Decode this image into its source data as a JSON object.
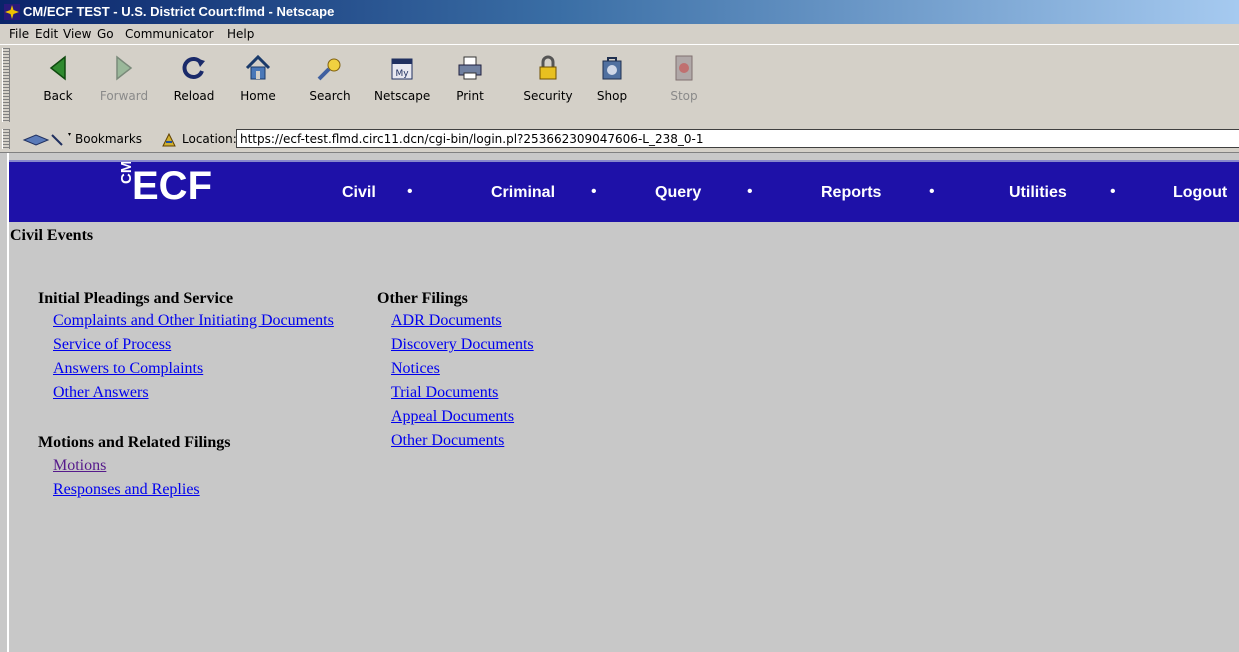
{
  "window": {
    "title": "CM/ECF TEST - U.S. District Court:flmd - Netscape"
  },
  "menu": [
    "File",
    "Edit",
    "View",
    "Go",
    "Communicator",
    "Help"
  ],
  "toolbar": {
    "back": "Back",
    "forward": "Forward",
    "reload": "Reload",
    "home": "Home",
    "search": "Search",
    "netscape": "Netscape",
    "print": "Print",
    "security": "Security",
    "shop": "Shop",
    "stop": "Stop"
  },
  "location": {
    "bookmarks_label": "Bookmarks",
    "location_label": "Location:",
    "url": "https://ecf-test.flmd.circ11.dcn/cgi-bin/login.pl?253662309047606-L_238_0-1"
  },
  "nav": {
    "logo_cm": "CM",
    "logo_ecf": "ECF",
    "items": [
      "Civil",
      "Criminal",
      "Query",
      "Reports",
      "Utilities",
      "Logout"
    ],
    "separator": "•",
    "bg_color": "#1e11a8"
  },
  "page": {
    "title": "Civil Events",
    "left_sections": [
      {
        "heading": "Initial Pleadings and Service",
        "links": [
          "Complaints and Other Initiating Documents",
          "Service of Process",
          "Answers to Complaints",
          "Other Answers"
        ]
      },
      {
        "heading": "Motions and Related Filings",
        "links": [
          "Motions",
          "Responses and Replies"
        ]
      }
    ],
    "right_section": {
      "heading": "Other Filings",
      "links": [
        "ADR Documents",
        "Discovery Documents",
        "Notices",
        "Trial Documents",
        "Appeal Documents",
        "Other Documents"
      ]
    }
  }
}
